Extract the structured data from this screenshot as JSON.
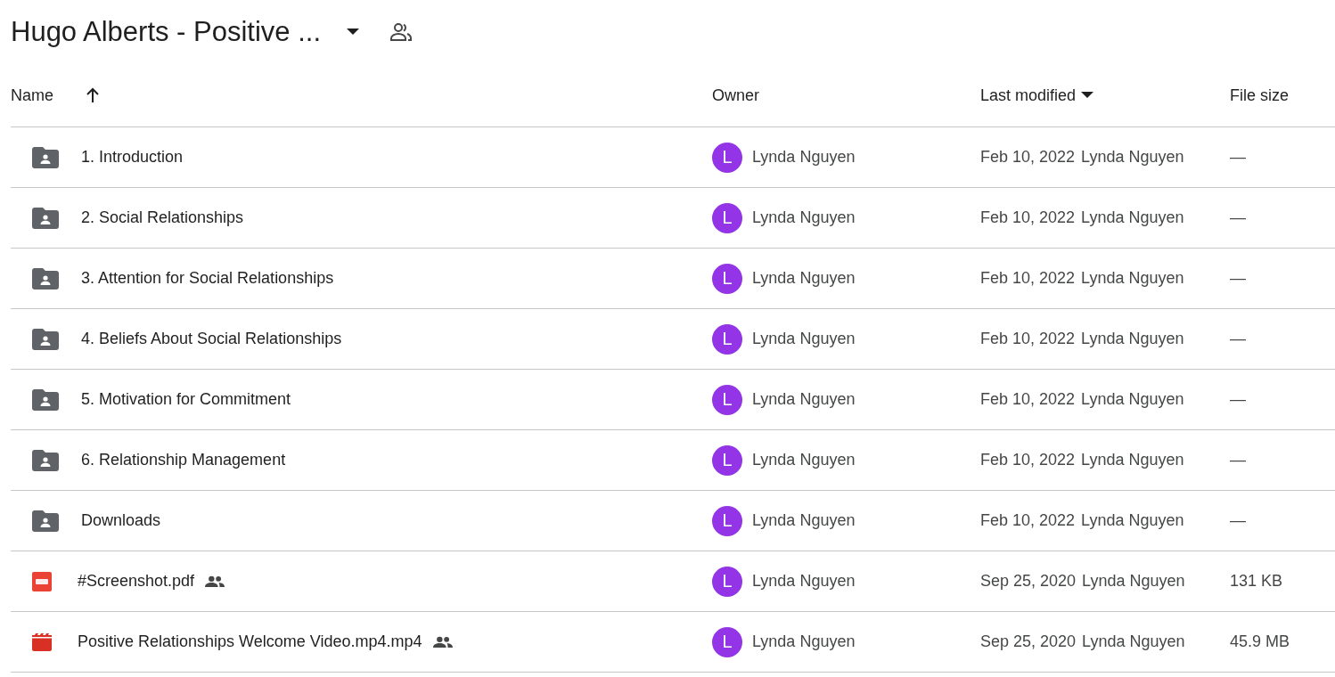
{
  "header": {
    "title": "Hugo Alberts - Positive ..."
  },
  "table": {
    "columns": [
      {
        "label": "Name",
        "kind": "arrow"
      },
      {
        "label": "Owner",
        "kind": "plain"
      },
      {
        "label": "Last modified",
        "kind": "menu"
      },
      {
        "label": "File size",
        "kind": "plain"
      }
    ],
    "rows": [
      {
        "kind": "folder",
        "name": "1. Introduction",
        "shared": false,
        "owner_initial": "L",
        "owner": "Lynda Nguyen",
        "modified": "Feb 10, 2022",
        "modified_by": "Lynda Nguyen",
        "size": "—"
      },
      {
        "kind": "folder",
        "name": "2. Social Relationships",
        "shared": false,
        "owner_initial": "L",
        "owner": "Lynda Nguyen",
        "modified": "Feb 10, 2022",
        "modified_by": "Lynda Nguyen",
        "size": "—"
      },
      {
        "kind": "folder",
        "name": "3. Attention for Social Relationships",
        "shared": false,
        "owner_initial": "L",
        "owner": "Lynda Nguyen",
        "modified": "Feb 10, 2022",
        "modified_by": "Lynda Nguyen",
        "size": "—"
      },
      {
        "kind": "folder",
        "name": "4. Beliefs About Social Relationships",
        "shared": false,
        "owner_initial": "L",
        "owner": "Lynda Nguyen",
        "modified": "Feb 10, 2022",
        "modified_by": "Lynda Nguyen",
        "size": "—"
      },
      {
        "kind": "folder",
        "name": "5. Motivation for Commitment",
        "shared": false,
        "owner_initial": "L",
        "owner": "Lynda Nguyen",
        "modified": "Feb 10, 2022",
        "modified_by": "Lynda Nguyen",
        "size": "—"
      },
      {
        "kind": "folder",
        "name": "6. Relationship Management",
        "shared": false,
        "owner_initial": "L",
        "owner": "Lynda Nguyen",
        "modified": "Feb 10, 2022",
        "modified_by": "Lynda Nguyen",
        "size": "—"
      },
      {
        "kind": "folder",
        "name": "Downloads",
        "shared": false,
        "owner_initial": "L",
        "owner": "Lynda Nguyen",
        "modified": "Feb 10, 2022",
        "modified_by": "Lynda Nguyen",
        "size": "—"
      },
      {
        "kind": "pdf",
        "name": "#Screenshot.pdf",
        "shared": true,
        "owner_initial": "L",
        "owner": "Lynda Nguyen",
        "modified": "Sep 25, 2020",
        "modified_by": "Lynda Nguyen",
        "size": "131 KB"
      },
      {
        "kind": "video",
        "name": "Positive Relationships Welcome Video.mp4.mp4",
        "shared": true,
        "owner_initial": "L",
        "owner": "Lynda Nguyen",
        "modified": "Sep 25, 2020",
        "modified_by": "Lynda Nguyen",
        "size": "45.9 MB"
      }
    ]
  }
}
